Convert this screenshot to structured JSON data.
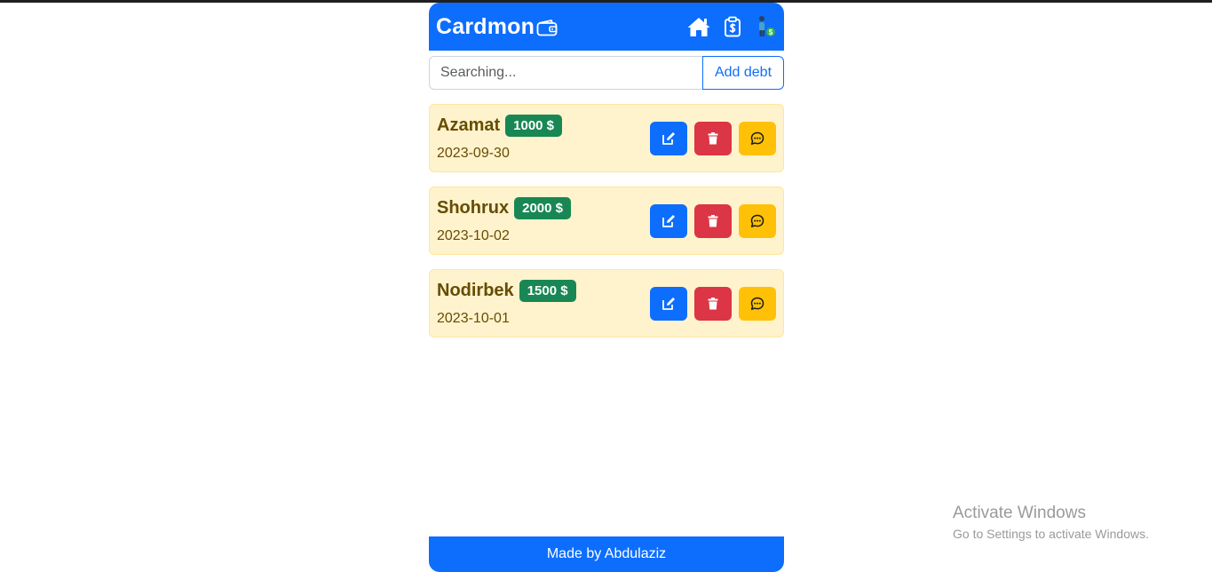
{
  "navbar": {
    "brand": "Cardmon",
    "icons": [
      "wallet-icon",
      "home-icon",
      "clipboard-dollar-icon",
      "person-money-icon"
    ]
  },
  "search": {
    "placeholder": "Searching...",
    "value": "",
    "add_button_label": "Add debt"
  },
  "debts": [
    {
      "name": "Azamat",
      "amount": "1000 $",
      "date": "2023-09-30"
    },
    {
      "name": "Shohrux",
      "amount": "2000 $",
      "date": "2023-10-02"
    },
    {
      "name": "Nodirbek",
      "amount": "1500 $",
      "date": "2023-10-01"
    }
  ],
  "card_actions": [
    "edit-icon",
    "trash-icon",
    "chat-icon"
  ],
  "footer": {
    "text": "Made by Abdulaziz"
  },
  "watermark": {
    "title": "Activate Windows",
    "subtitle": "Go to Settings to activate Windows."
  },
  "colors": {
    "primary": "#0d6efd",
    "danger": "#dc3545",
    "warning": "#ffc107",
    "success": "#198754",
    "card_bg": "#fff3cd",
    "card_text": "#664d03"
  }
}
